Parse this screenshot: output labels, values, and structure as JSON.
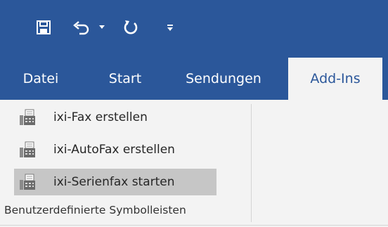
{
  "colors": {
    "accent": "#2b579a",
    "ribbon_bg": "#f3f3f3",
    "hover": "#c6c6c6"
  },
  "quick_access": [
    {
      "icon": "save-icon"
    },
    {
      "icon": "undo-icon"
    },
    {
      "icon": "dropdown-arrow-icon"
    },
    {
      "icon": "redo-icon"
    },
    {
      "icon": "customize-toolbar-icon"
    }
  ],
  "tabs": [
    {
      "label": "Datei"
    },
    {
      "label": "Start"
    },
    {
      "label": "Sendungen"
    },
    {
      "label": "Add-Ins",
      "active": true
    }
  ],
  "ribbon": {
    "items": [
      {
        "label": "ixi-Fax erstellen",
        "icon": "fax-icon"
      },
      {
        "label": "ixi-AutoFax erstellen",
        "icon": "fax-icon"
      },
      {
        "label": "ixi-Serienfax starten",
        "icon": "fax-icon",
        "hovered": true
      }
    ],
    "group_label": "Benutzerdefinierte Symbolleisten"
  }
}
